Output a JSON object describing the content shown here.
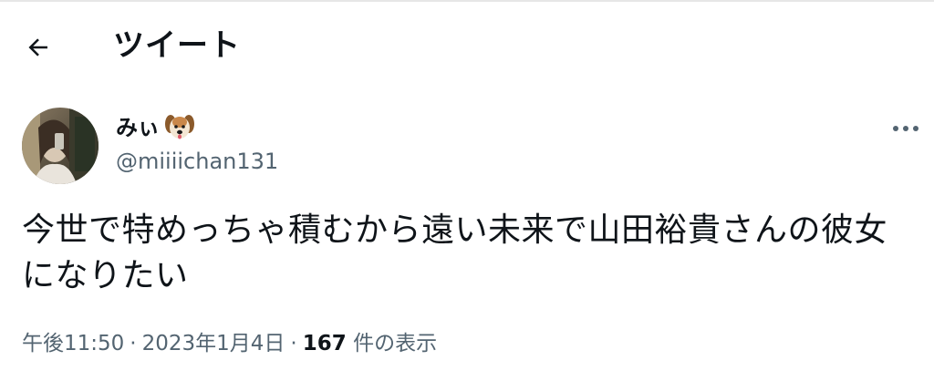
{
  "header": {
    "title": "ツイート",
    "back_icon": "arrow-left-icon"
  },
  "author": {
    "display_name": "みぃ",
    "name_emoji": "dog-face-icon",
    "handle": "@miiiichan131"
  },
  "tweet": {
    "text": "今世で特めっちゃ積むから遠い未来で山田裕貴さんの彼女になりたい"
  },
  "meta": {
    "time": "午後11:50",
    "separator": "·",
    "date": "2023年1月4日",
    "views_count": "167",
    "views_label": "件の表示"
  },
  "colors": {
    "text": "#0f1419",
    "secondary": "#536471",
    "background": "#ffffff"
  }
}
